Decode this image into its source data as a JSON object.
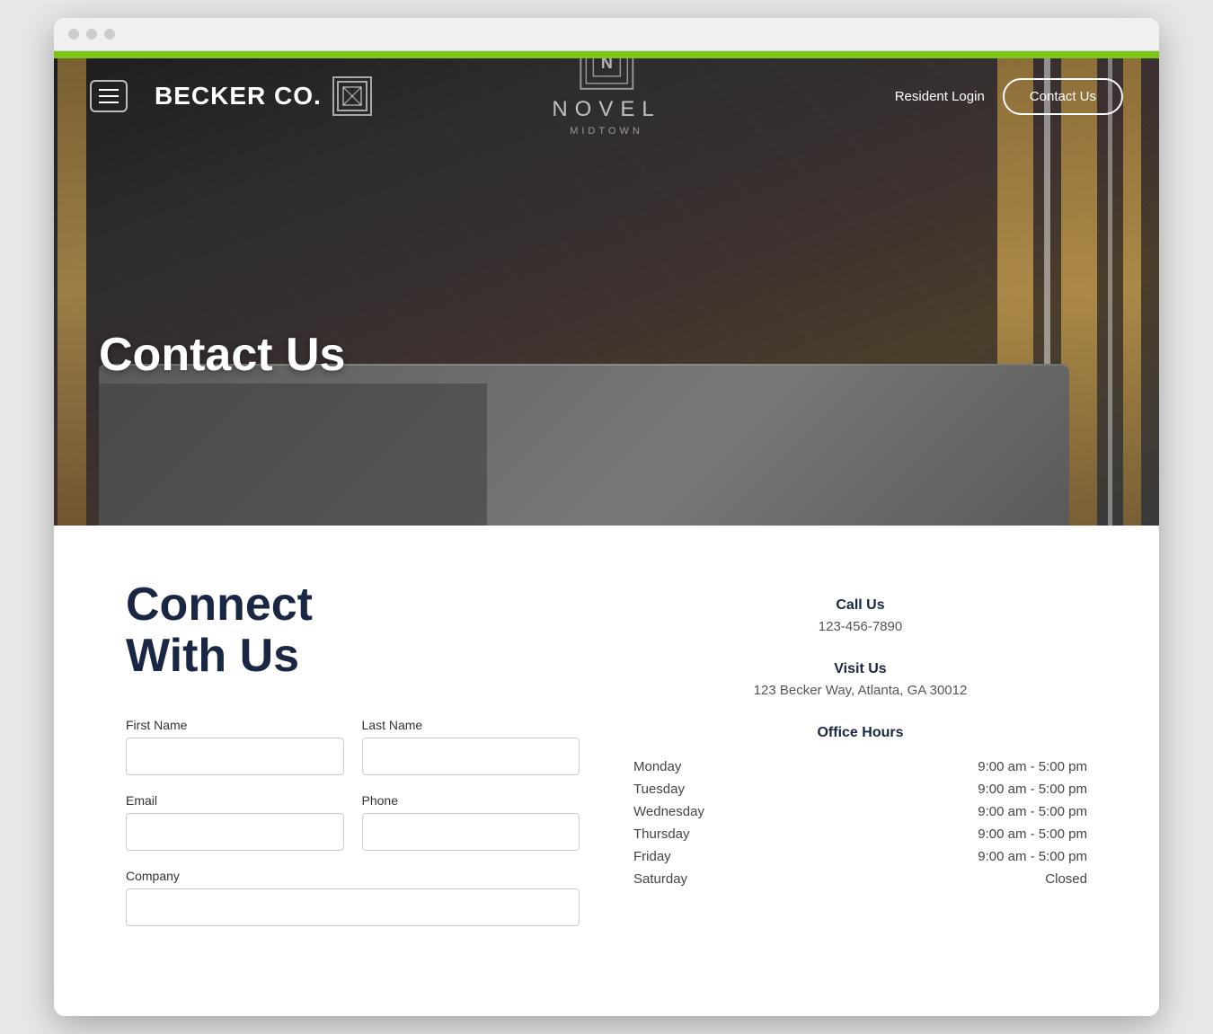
{
  "browser": {
    "dots": [
      "dot1",
      "dot2",
      "dot3"
    ]
  },
  "greenBar": {},
  "navbar": {
    "logo_text": "BECKER CO.",
    "logo_icon": "N",
    "resident_login": "Resident Login",
    "contact_us_btn": "Contact Us"
  },
  "novel": {
    "title": "NOVEL",
    "subtitle": "MIDTOWN"
  },
  "hero": {
    "title": "Contact Us"
  },
  "main": {
    "heading_line1": "Connect",
    "heading_line2": "With Us",
    "form": {
      "first_name_label": "First Name",
      "last_name_label": "Last Name",
      "email_label": "Email",
      "phone_label": "Phone",
      "company_label": "Company"
    },
    "contact_info": {
      "call_us_label": "Call Us",
      "phone": "123-456-7890",
      "visit_us_label": "Visit Us",
      "address": "123 Becker Way, Atlanta, GA 30012",
      "office_hours_label": "Office Hours",
      "hours": [
        {
          "day": "Monday",
          "time": "9:00 am - 5:00 pm"
        },
        {
          "day": "Tuesday",
          "time": "9:00 am - 5:00 pm"
        },
        {
          "day": "Wednesday",
          "time": "9:00 am - 5:00 pm"
        },
        {
          "day": "Thursday",
          "time": "9:00 am - 5:00 pm"
        },
        {
          "day": "Friday",
          "time": "9:00 am - 5:00 pm"
        },
        {
          "day": "Saturday",
          "time": "Closed"
        }
      ]
    }
  },
  "colors": {
    "accent_green": "#7dc419",
    "dark_navy": "#1a2744",
    "hero_overlay": "rgba(0,0,0,0.35)"
  }
}
